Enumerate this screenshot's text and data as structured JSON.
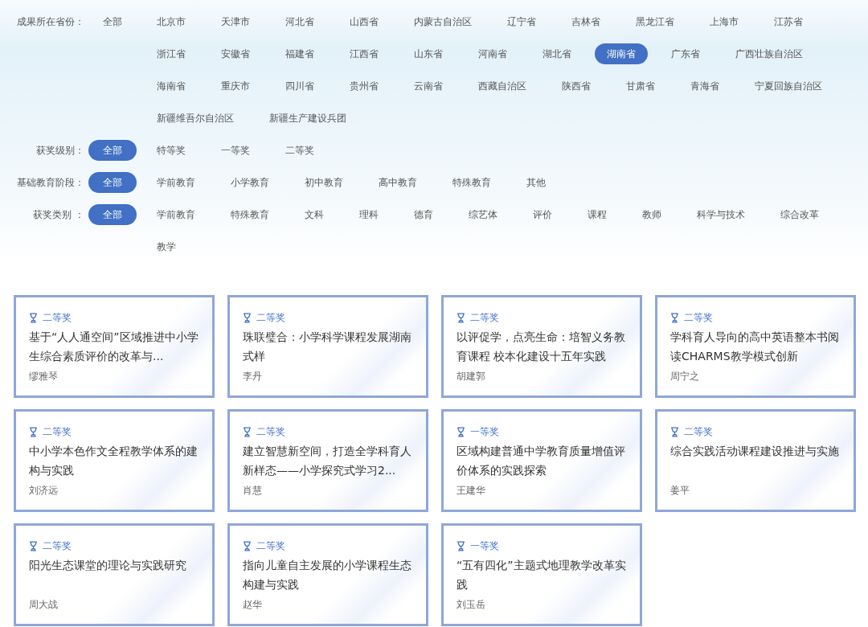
{
  "filters": [
    {
      "label": "成果所在省份：",
      "options": [
        {
          "label": "全部",
          "selected": false
        },
        {
          "label": "北京市",
          "selected": false
        },
        {
          "label": "天津市",
          "selected": false
        },
        {
          "label": "河北省",
          "selected": false
        },
        {
          "label": "山西省",
          "selected": false
        },
        {
          "label": "内蒙古自治区",
          "selected": false
        },
        {
          "label": "辽宁省",
          "selected": false
        },
        {
          "label": "吉林省",
          "selected": false
        },
        {
          "label": "黑龙江省",
          "selected": false
        },
        {
          "label": "上海市",
          "selected": false
        },
        {
          "label": "江苏省",
          "selected": false
        },
        {
          "label": "浙江省",
          "selected": false
        },
        {
          "label": "安徽省",
          "selected": false
        },
        {
          "label": "福建省",
          "selected": false
        },
        {
          "label": "江西省",
          "selected": false
        },
        {
          "label": "山东省",
          "selected": false
        },
        {
          "label": "河南省",
          "selected": false
        },
        {
          "label": "湖北省",
          "selected": false
        },
        {
          "label": "湖南省",
          "selected": true
        },
        {
          "label": "广东省",
          "selected": false
        },
        {
          "label": "广西壮族自治区",
          "selected": false
        },
        {
          "label": "海南省",
          "selected": false
        },
        {
          "label": "重庆市",
          "selected": false
        },
        {
          "label": "四川省",
          "selected": false
        },
        {
          "label": "贵州省",
          "selected": false
        },
        {
          "label": "云南省",
          "selected": false
        },
        {
          "label": "西藏自治区",
          "selected": false
        },
        {
          "label": "陕西省",
          "selected": false
        },
        {
          "label": "甘肃省",
          "selected": false
        },
        {
          "label": "青海省",
          "selected": false
        },
        {
          "label": "宁夏回族自治区",
          "selected": false
        },
        {
          "label": "新疆维吾尔自治区",
          "selected": false
        },
        {
          "label": "新疆生产建设兵团",
          "selected": false
        }
      ]
    },
    {
      "label": "获奖级别：",
      "options": [
        {
          "label": "全部",
          "selected": true
        },
        {
          "label": "特等奖",
          "selected": false
        },
        {
          "label": "一等奖",
          "selected": false
        },
        {
          "label": "二等奖",
          "selected": false
        }
      ]
    },
    {
      "label": "基础教育阶段：",
      "options": [
        {
          "label": "全部",
          "selected": true
        },
        {
          "label": "学前教育",
          "selected": false
        },
        {
          "label": "小学教育",
          "selected": false
        },
        {
          "label": "初中教育",
          "selected": false
        },
        {
          "label": "高中教育",
          "selected": false
        },
        {
          "label": "特殊教育",
          "selected": false
        },
        {
          "label": "其他",
          "selected": false
        }
      ]
    },
    {
      "label": "获奖类别 ：",
      "options": [
        {
          "label": "全部",
          "selected": true
        },
        {
          "label": "学前教育",
          "selected": false
        },
        {
          "label": "特殊教育",
          "selected": false
        },
        {
          "label": "文科",
          "selected": false
        },
        {
          "label": "理科",
          "selected": false
        },
        {
          "label": "德育",
          "selected": false
        },
        {
          "label": "综艺体",
          "selected": false
        },
        {
          "label": "评价",
          "selected": false
        },
        {
          "label": "课程",
          "selected": false
        },
        {
          "label": "教师",
          "selected": false
        },
        {
          "label": "科学与技术",
          "selected": false
        },
        {
          "label": "综合改革",
          "selected": false
        },
        {
          "label": "教学",
          "selected": false
        }
      ]
    }
  ],
  "results": [
    {
      "award": "二等奖",
      "title": "基于“人人通空间”区域推进中小学生综合素质评价的改革与...",
      "author": "缪雅琴"
    },
    {
      "award": "二等奖",
      "title": "珠联璧合：小学科学课程发展湖南式样",
      "author": "李丹"
    },
    {
      "award": "二等奖",
      "title": "以评促学，点亮生命：培智义务教育课程 校本化建设十五年实践",
      "author": "胡建郭"
    },
    {
      "award": "二等奖",
      "title": "学科育人导向的高中英语整本书阅读CHARMS教学模式创新",
      "author": "周宁之"
    },
    {
      "award": "二等奖",
      "title": "中小学本色作文全程教学体系的建构与实践",
      "author": "刘济远"
    },
    {
      "award": "二等奖",
      "title": "建立智慧新空间，打造全学科育人新样态——小学探究式学习2...",
      "author": "肖慧"
    },
    {
      "award": "一等奖",
      "title": "区域构建普通中学教育质量增值评价体系的实践探索",
      "author": "王建华"
    },
    {
      "award": "二等奖",
      "title": "综合实践活动课程建设推进与实施",
      "author": "姜平"
    },
    {
      "award": "二等奖",
      "title": "阳光生态课堂的理论与实践研究",
      "author": "周大战"
    },
    {
      "award": "二等奖",
      "title": "指向儿童自主发展的小学课程生态构建与实践",
      "author": "赵华"
    },
    {
      "award": "一等奖",
      "title": "“五有四化”主题式地理教学改革实践",
      "author": "刘玉岳"
    }
  ]
}
